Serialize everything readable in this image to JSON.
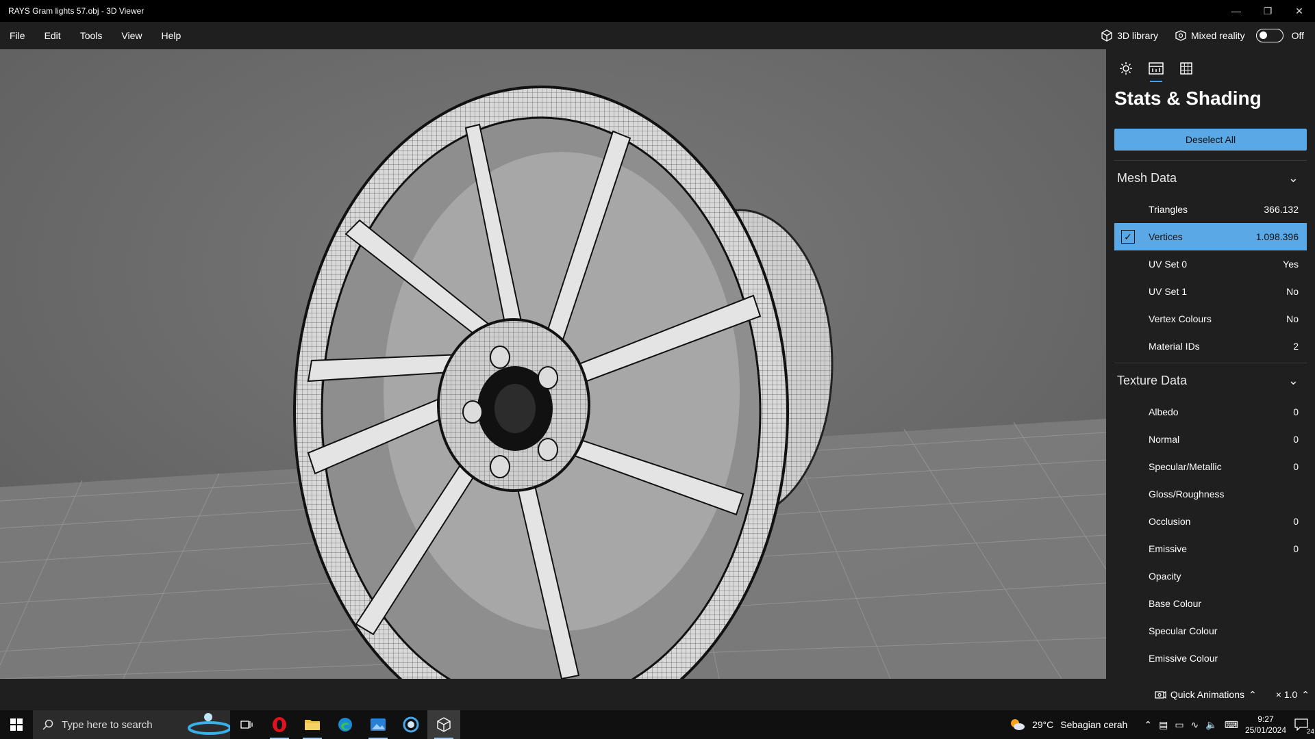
{
  "window": {
    "title": "RAYS Gram lights 57.obj - 3D Viewer"
  },
  "menu": {
    "items": [
      "File",
      "Edit",
      "Tools",
      "View",
      "Help"
    ],
    "library_label": "3D library",
    "mixed_reality_label": "Mixed reality",
    "mixed_reality_state": "Off"
  },
  "panel": {
    "title": "Stats & Shading",
    "deselect_label": "Deselect All",
    "mesh_section": "Mesh Data",
    "mesh_rows": [
      {
        "label": "Triangles",
        "value": "366.132"
      },
      {
        "label": "Vertices",
        "value": "1.098.396"
      },
      {
        "label": "UV Set 0",
        "value": "Yes"
      },
      {
        "label": "UV Set 1",
        "value": "No"
      },
      {
        "label": "Vertex Colours",
        "value": "No"
      },
      {
        "label": "Material IDs",
        "value": "2"
      }
    ],
    "texture_section": "Texture Data",
    "texture_rows": [
      {
        "label": "Albedo",
        "value": "0"
      },
      {
        "label": "Normal",
        "value": "0"
      },
      {
        "label": "Specular/Metallic",
        "value": "0"
      },
      {
        "label": "Gloss/Roughness",
        "value": ""
      },
      {
        "label": "Occlusion",
        "value": "0"
      },
      {
        "label": "Emissive",
        "value": "0"
      },
      {
        "label": "Opacity",
        "value": ""
      },
      {
        "label": "Base Colour",
        "value": ""
      },
      {
        "label": "Specular Colour",
        "value": ""
      },
      {
        "label": "Emissive Colour",
        "value": ""
      }
    ]
  },
  "statusbar": {
    "quick_animations": "Quick Animations",
    "speed": "× 1.0"
  },
  "taskbar": {
    "search_placeholder": "Type here to search",
    "weather_temp": "29°C",
    "weather_desc": "Sebagian cerah",
    "time": "9:27",
    "date": "25/01/2024",
    "notification_count": "24"
  },
  "colors": {
    "accent": "#5aa8e6",
    "viewport_bg": "#6d6d6d",
    "panel_bg": "#1f1f1f"
  }
}
